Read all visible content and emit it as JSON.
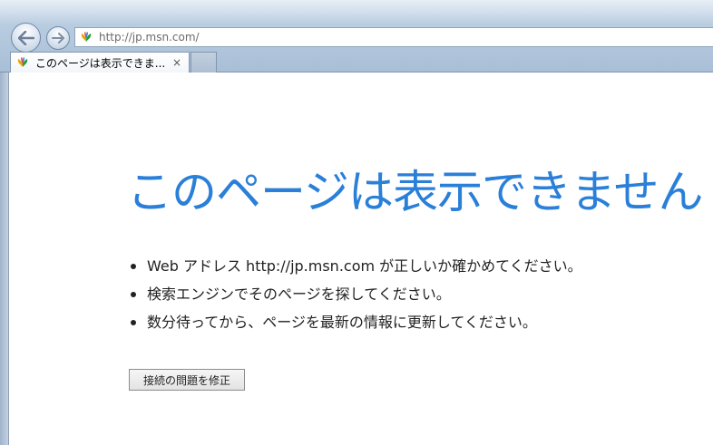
{
  "browser": {
    "url": "http://jp.msn.com/",
    "tab_title": "このページは表示できま...",
    "tab_close": "×",
    "accent_color": "#2a7fd8"
  },
  "icons": {
    "back": "back-arrow-icon",
    "forward": "forward-arrow-icon",
    "site": "msn-butterfly-icon",
    "close": "close-icon"
  },
  "error_page": {
    "title": "このページは表示できません",
    "suggestions": [
      "Web アドレス http://jp.msn.com が正しいか確かめてください。",
      "検索エンジンでそのページを探してください。",
      "数分待ってから、ページを最新の情報に更新してください。"
    ],
    "fix_button_label": "接続の問題を修正"
  }
}
